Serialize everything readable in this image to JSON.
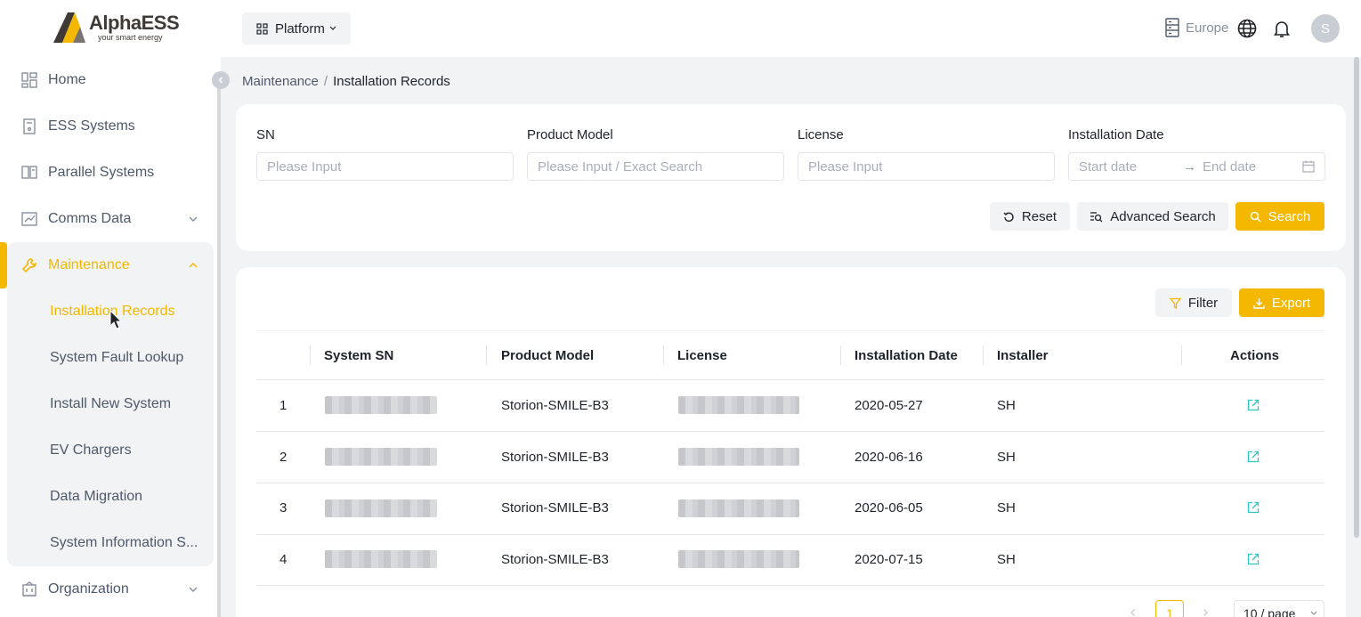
{
  "brand": {
    "name": "AlphaESS",
    "tagline": "your smart energy",
    "accent": "#f5b800"
  },
  "sidebar": {
    "items": [
      {
        "label": "Home",
        "icon": "dashboard-grid-icon"
      },
      {
        "label": "ESS Systems",
        "icon": "device-icon"
      },
      {
        "label": "Parallel Systems",
        "icon": "parallel-book-icon"
      },
      {
        "label": "Comms Data",
        "icon": "chart-icon"
      },
      {
        "label": "Maintenance",
        "icon": "wrench-icon"
      },
      {
        "label": "Organization",
        "icon": "building-icon"
      }
    ],
    "maintenance_sub": [
      "Installation Records",
      "System Fault Lookup",
      "Install New System",
      "EV Chargers",
      "Data Migration",
      "System Information S..."
    ]
  },
  "topbar": {
    "platform": "Platform",
    "region": "Europe",
    "avatar_initial": "S"
  },
  "breadcrumb": {
    "parent": "Maintenance",
    "separator": "/",
    "current": "Installation Records"
  },
  "filters": {
    "sn": {
      "label": "SN",
      "placeholder": "Please Input"
    },
    "model": {
      "label": "Product Model",
      "placeholder": "Please Input / Exact Search"
    },
    "license": {
      "label": "License",
      "placeholder": "Please Input"
    },
    "date": {
      "label": "Installation Date",
      "start": "Start date",
      "arrow": "→",
      "end": "End date"
    },
    "reset": "Reset",
    "advanced": "Advanced Search",
    "search": "Search"
  },
  "table": {
    "filter": "Filter",
    "export": "Export",
    "headers": [
      "System SN",
      "Product Model",
      "License",
      "Installation Date",
      "Installer",
      "Actions"
    ],
    "rows": [
      {
        "index": "1",
        "model": "Storion-SMILE-B3",
        "date": "2020-05-27",
        "installer": "SH"
      },
      {
        "index": "2",
        "model": "Storion-SMILE-B3",
        "date": "2020-06-16",
        "installer": "SH"
      },
      {
        "index": "3",
        "model": "Storion-SMILE-B3",
        "date": "2020-06-05",
        "installer": "SH"
      },
      {
        "index": "4",
        "model": "Storion-SMILE-B3",
        "date": "2020-07-15",
        "installer": "SH"
      }
    ]
  },
  "pagination": {
    "page": "1",
    "page_size": "10 / page"
  }
}
